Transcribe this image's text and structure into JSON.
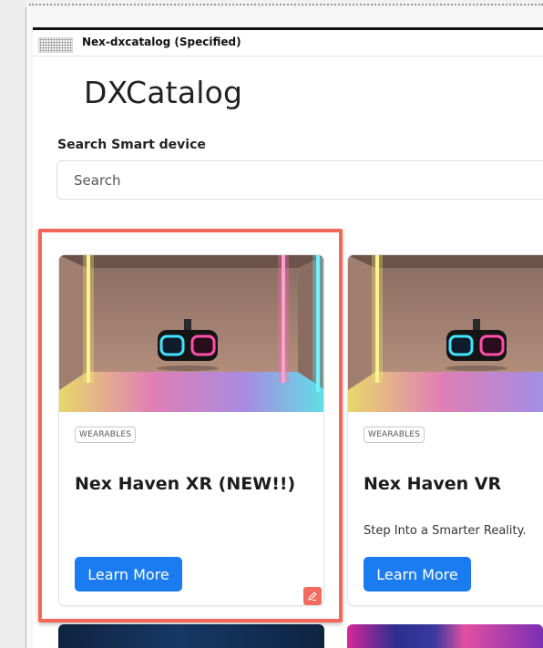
{
  "window": {
    "title": "Nex-dxcatalog (Specified)"
  },
  "app": {
    "title": "DXCatalog"
  },
  "search": {
    "label": "Search Smart device",
    "placeholder": "Search"
  },
  "cards": [
    {
      "category": "WEARABLES",
      "title": "Nex Haven XR (NEW!!)",
      "description": "",
      "button_label": "Learn More",
      "image_icon": "vr-headset-neon-room",
      "selected": true
    },
    {
      "category": "WEARABLES",
      "title": "Nex Haven VR",
      "description": "Step Into a Smarter Reality.",
      "button_label": "Learn More",
      "image_icon": "vr-headset-neon-room"
    }
  ],
  "colors": {
    "button": "#1a7cf0",
    "highlight": "#f4685a",
    "edit_badge": "#f26d5f"
  }
}
